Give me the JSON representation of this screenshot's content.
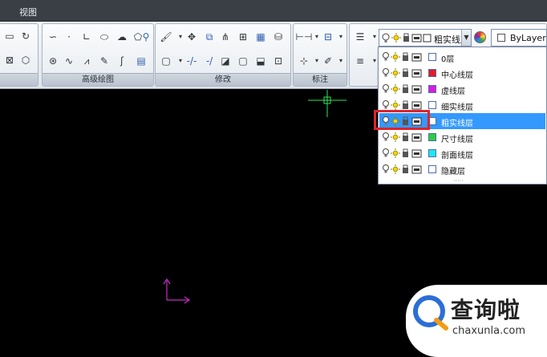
{
  "menu": {
    "items": [
      "视图"
    ]
  },
  "panels": {
    "draw_advanced": {
      "title": "高级绘图"
    },
    "modify": {
      "title": "修改"
    },
    "dimension": {
      "title": "标注"
    }
  },
  "layer_control": {
    "current_layer": "粗实线层",
    "color_label": "ByLayer",
    "layers": [
      {
        "name": "0层",
        "color": "#ffffff",
        "selected": false
      },
      {
        "name": "中心线层",
        "color": "#e51c23",
        "selected": false
      },
      {
        "name": "虚线层",
        "color": "#d81ddf",
        "selected": false
      },
      {
        "name": "细实线层",
        "color": "#ffffff",
        "selected": false
      },
      {
        "name": "粗实线层",
        "color": "#ffffff",
        "selected": true
      },
      {
        "name": "尺寸线层",
        "color": "#2ecc40",
        "selected": false
      },
      {
        "name": "剖面线层",
        "color": "#1fe6f0",
        "selected": false
      },
      {
        "name": "隐藏层",
        "color": "#ffffff",
        "selected": false
      }
    ]
  },
  "watermark": {
    "brand": "查询啦",
    "url": "chaxunla.com"
  },
  "colors": {
    "highlight": "#e0222a",
    "selection": "#3399ff",
    "crosshair": "#2ee85a",
    "ucs": "#c330c3"
  }
}
